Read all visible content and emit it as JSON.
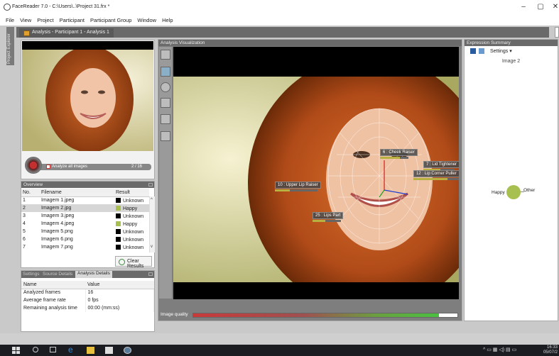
{
  "window": {
    "title": "FaceReader 7.0 - C:\\Users\\..\\Project 31.frx *",
    "controls": {
      "minimize": "–",
      "maximize": "▢",
      "close": "✕"
    }
  },
  "menu": [
    "File",
    "View",
    "Project",
    "Participant",
    "Participant Group",
    "Window",
    "Help"
  ],
  "sidebar": {
    "project_explorer": "Project Explorer"
  },
  "doc_tab": "Analysis - Participant 1 - Analysis 1",
  "player": {
    "analyze_all": "Analyze all images",
    "counter": "2 / 16"
  },
  "overview": {
    "title": "Overview",
    "columns": [
      "No.",
      "Filename",
      "Result"
    ],
    "rows": [
      {
        "no": "1",
        "file": "Imagem 1.jpeg",
        "result": "Unknown",
        "color": "#000000"
      },
      {
        "no": "2",
        "file": "Imagem 2.jpg",
        "result": "Happy",
        "color": "#a8c050"
      },
      {
        "no": "3",
        "file": "Imagem 3.jpeg",
        "result": "Unknown",
        "color": "#000000"
      },
      {
        "no": "4",
        "file": "Imagem 4.jpeg",
        "result": "Happy",
        "color": "#a8c050"
      },
      {
        "no": "5",
        "file": "Imagem 5.png",
        "result": "Unknown",
        "color": "#000000"
      },
      {
        "no": "6",
        "file": "Imagem 6.png",
        "result": "Unknown",
        "color": "#000000"
      },
      {
        "no": "7",
        "file": "Imagem 7.png",
        "result": "Unknown",
        "color": "#000000"
      }
    ],
    "clear_results": "Clear Results"
  },
  "details": {
    "tabs": [
      "Settings",
      "Source Details",
      "Analysis Details"
    ],
    "columns": [
      "Name",
      "Value"
    ],
    "rows": [
      {
        "name": "Analyzed frames",
        "value": "16"
      },
      {
        "name": "Average frame rate",
        "value": "0 fps"
      },
      {
        "name": "Remaining analysis time",
        "value": "00:00 (mm:ss)"
      }
    ]
  },
  "visualization": {
    "title": "Analysis Visualization",
    "labels": [
      {
        "text": "6 : Cheek Raiser"
      },
      {
        "text": "7 : Lid Tightener"
      },
      {
        "text": "12 : Lip Corner Puller"
      },
      {
        "text": "10 : Upper Lip Raiser"
      },
      {
        "text": "25 : Lips Part"
      }
    ],
    "image_quality_label": "Image quality",
    "image_quality": 0.93
  },
  "expression": {
    "title": "Expression Summary",
    "settings": "Settings ▾",
    "image_label": "Image 2",
    "pie": [
      {
        "label": "Happy",
        "color": "#a8c050"
      },
      {
        "label": "Other",
        "color": "#cccccc"
      }
    ]
  },
  "taskbar": {
    "time": "16:33",
    "date": "05/07/2"
  }
}
